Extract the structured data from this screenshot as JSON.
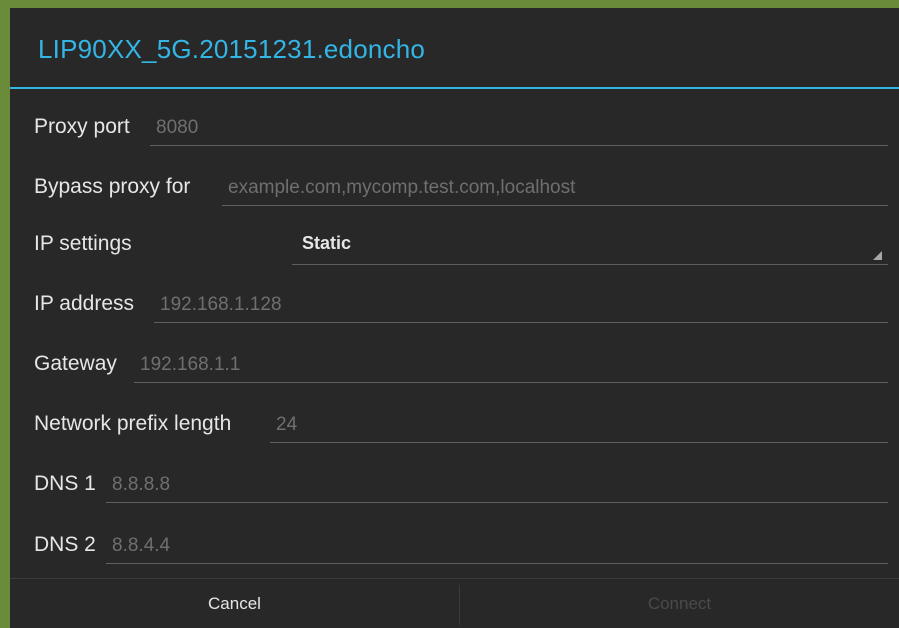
{
  "dialog": {
    "title": "LIP90XX_5G.20151231.edoncho",
    "accent_color": "#33b5e5",
    "background_color": "#282828"
  },
  "fields": {
    "proxy_port": {
      "label": "Proxy port",
      "placeholder": "8080"
    },
    "bypass_proxy": {
      "label": "Bypass proxy for",
      "placeholder": "example.com,mycomp.test.com,localhost"
    },
    "ip_settings": {
      "label": "IP settings",
      "selected": "Static"
    },
    "ip_address": {
      "label": "IP address",
      "placeholder": "192.168.1.128"
    },
    "gateway": {
      "label": "Gateway",
      "placeholder": "192.168.1.1"
    },
    "prefix_length": {
      "label": "Network prefix length",
      "placeholder": "24"
    },
    "dns1": {
      "label": "DNS 1",
      "placeholder": "8.8.8.8"
    },
    "dns2": {
      "label": "DNS 2",
      "placeholder": "8.8.4.4"
    }
  },
  "buttons": {
    "cancel": "Cancel",
    "connect": "Connect",
    "connect_state": "disabled"
  }
}
